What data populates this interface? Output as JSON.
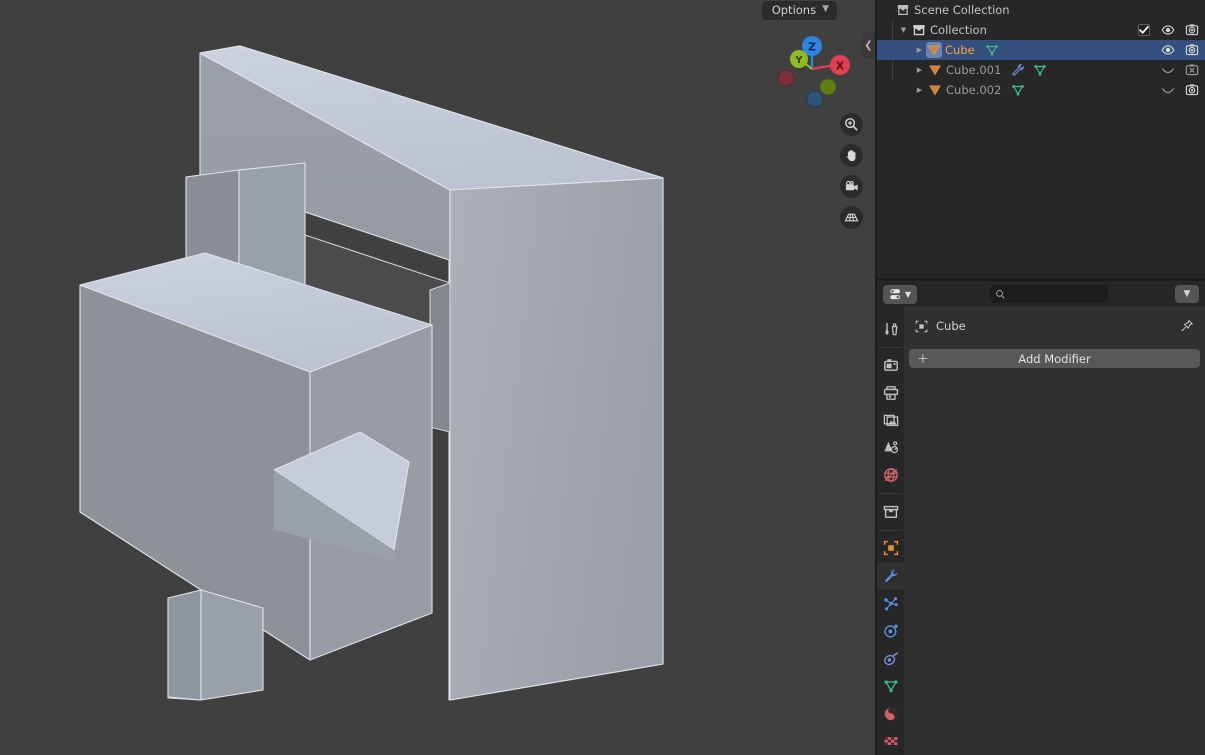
{
  "app": "Blender",
  "viewport": {
    "options_button": {
      "label": "Options",
      "chevron": "chevron-down-icon"
    },
    "collapse_tab": {
      "glyph": "❮",
      "name": "collapse-sidebar-tab"
    },
    "background_color": "#404040",
    "gizmo": {
      "axes": [
        {
          "label": "Z",
          "color": "#2f83e3",
          "name": "gizmo-axis-z-positive"
        },
        {
          "label": "Y",
          "color": "#8ebb25",
          "name": "gizmo-axis-y-positive"
        },
        {
          "label": "X",
          "color": "#e04051",
          "name": "gizmo-axis-x-positive"
        },
        {
          "label": "",
          "color": "#7c3039",
          "name": "gizmo-axis-x-negative"
        },
        {
          "label": "",
          "color": "#5e7c18",
          "name": "gizmo-axis-y-negative"
        },
        {
          "label": "",
          "color": "#2a5578",
          "name": "gizmo-axis-z-negative"
        }
      ]
    },
    "tools": [
      {
        "name": "zoom-icon",
        "title": "Zoom"
      },
      {
        "name": "hand-icon",
        "title": "Move View"
      },
      {
        "name": "camera-icon",
        "title": "Camera View"
      },
      {
        "name": "grid-icon",
        "title": "Toggle Orthographic"
      }
    ],
    "object_color": "#a8acb4"
  },
  "outliner": {
    "background_color": "#272727",
    "selected_color": "#34507f",
    "active_text_color": "#ffa13c",
    "rows": [
      {
        "label": "Scene Collection",
        "indent": 0,
        "icon": "scene-collection-icon",
        "disclosure": "",
        "selected": false,
        "dim": false,
        "active": false,
        "extras": [],
        "right_icons": []
      },
      {
        "label": "Collection",
        "indent": 1,
        "icon": "collection-icon",
        "disclosure": "▼",
        "selected": false,
        "dim": false,
        "active": false,
        "extras": [],
        "right_icons": [
          "checkbox-checked-icon",
          "eye-open-icon",
          "camera-on-icon"
        ]
      },
      {
        "label": "Cube",
        "indent": 2,
        "icon": "mesh-object-icon",
        "disclosure": "▶",
        "selected": true,
        "dim": false,
        "active": true,
        "extras": [
          "mesh-data-icon"
        ],
        "right_icons": [
          "eye-open-icon",
          "camera-on-icon"
        ]
      },
      {
        "label": "Cube.001",
        "indent": 2,
        "icon": "mesh-object-icon",
        "disclosure": "▶",
        "selected": false,
        "dim": true,
        "active": false,
        "extras": [
          "modifier-wrench-icon",
          "mesh-data-icon"
        ],
        "right_icons": [
          "eye-closed-icon",
          "camera-off-icon"
        ]
      },
      {
        "label": "Cube.002",
        "indent": 2,
        "icon": "mesh-object-icon",
        "disclosure": "▶",
        "selected": false,
        "dim": true,
        "active": false,
        "extras": [
          "mesh-data-icon"
        ],
        "right_icons": [
          "eye-closed-icon",
          "camera-on-icon"
        ]
      }
    ]
  },
  "properties": {
    "background_color": "#303030",
    "header": {
      "editor_type_icon": "properties-editor-icon",
      "editor_type_chevron": "chevron-down-icon",
      "search_placeholder": "",
      "search_value": "",
      "search_icon": "search-icon",
      "filter_chevron": "chevron-down-icon"
    },
    "tabs": [
      {
        "name": "tool-tab",
        "icon": "tool-icon",
        "color": "#c0c0c0",
        "active": false,
        "gap_before": false
      },
      {
        "name": "render-tab",
        "icon": "render-camera-icon",
        "color": "#c0c0c0",
        "active": false,
        "gap_before": true
      },
      {
        "name": "output-tab",
        "icon": "printer-icon",
        "color": "#c0c0c0",
        "active": false,
        "gap_before": false
      },
      {
        "name": "view-layer-tab",
        "icon": "images-icon",
        "color": "#c0c0c0",
        "active": false,
        "gap_before": false
      },
      {
        "name": "scene-tab",
        "icon": "scene-cone-icon",
        "color": "#c0c0c0",
        "active": false,
        "gap_before": false
      },
      {
        "name": "world-tab",
        "icon": "world-globe-icon",
        "color": "#c9636b",
        "active": false,
        "gap_before": false
      },
      {
        "name": "collection-tab",
        "icon": "collection-box-icon",
        "color": "#c0c0c0",
        "active": false,
        "gap_before": true
      },
      {
        "name": "object-tab",
        "icon": "object-square-icon",
        "color": "#e08c3a",
        "active": false,
        "gap_before": true
      },
      {
        "name": "modifier-tab",
        "icon": "wrench-icon",
        "color": "#5a8fdd",
        "active": true,
        "gap_before": false
      },
      {
        "name": "particles-tab",
        "icon": "particles-icon",
        "color": "#5a8fdd",
        "active": false,
        "gap_before": false
      },
      {
        "name": "physics-tab",
        "icon": "physics-orbit-icon",
        "color": "#5a8fdd",
        "active": false,
        "gap_before": false
      },
      {
        "name": "constraints-tab",
        "icon": "constraint-icon",
        "color": "#7c8fe0",
        "active": false,
        "gap_before": false
      },
      {
        "name": "data-tab",
        "icon": "mesh-data-icon",
        "color": "#3fbf8f",
        "active": false,
        "gap_before": false
      },
      {
        "name": "material-tab",
        "icon": "material-sphere-icon",
        "color": "#c9636b",
        "active": false,
        "gap_before": false
      },
      {
        "name": "texture-tab",
        "icon": "texture-checker-icon",
        "color": "#c9636b",
        "active": false,
        "gap_before": false
      }
    ],
    "breadcrumb": {
      "object_icon": "object-square-icon",
      "label": "Cube",
      "pin_icon": "pin-icon"
    },
    "add_modifier": {
      "label": "Add Modifier",
      "plus": "+"
    }
  }
}
